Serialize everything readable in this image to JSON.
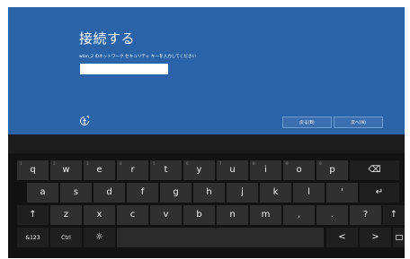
{
  "dialog": {
    "title": "接続する",
    "subtitle": "wlan_2 のネットワーク セキュリティ キーを入力してください",
    "password_value": "",
    "back_label": "戻る(B)",
    "next_label": "次へ(N)"
  },
  "keyboard": {
    "row1": [
      {
        "num": "1",
        "label": "q"
      },
      {
        "num": "2",
        "label": "w"
      },
      {
        "num": "3",
        "label": "e"
      },
      {
        "num": "4",
        "label": "r"
      },
      {
        "num": "5",
        "label": "t"
      },
      {
        "num": "6",
        "label": "y"
      },
      {
        "num": "7",
        "label": "u"
      },
      {
        "num": "8",
        "label": "i"
      },
      {
        "num": "9",
        "label": "o"
      },
      {
        "num": "0",
        "label": "p"
      },
      {
        "num": "",
        "label": "⌫"
      }
    ],
    "row2": [
      {
        "label": "a"
      },
      {
        "label": "s"
      },
      {
        "label": "d"
      },
      {
        "label": "f"
      },
      {
        "label": "g"
      },
      {
        "label": "h"
      },
      {
        "label": "j"
      },
      {
        "label": "k"
      },
      {
        "label": "l"
      },
      {
        "label": "'"
      },
      {
        "label": "↵"
      }
    ],
    "row3": [
      {
        "label": "↑"
      },
      {
        "label": "z"
      },
      {
        "label": "x"
      },
      {
        "label": "c"
      },
      {
        "label": "v"
      },
      {
        "label": "b"
      },
      {
        "label": "n"
      },
      {
        "label": "m"
      },
      {
        "label": ","
      },
      {
        "label": "."
      },
      {
        "label": "?"
      },
      {
        "label": "↑"
      }
    ],
    "row4": {
      "symbols_label": "&123",
      "ctrl_label": "Ctrl",
      "brightness_label": "☼",
      "left_label": "<",
      "right_label": ">"
    }
  }
}
